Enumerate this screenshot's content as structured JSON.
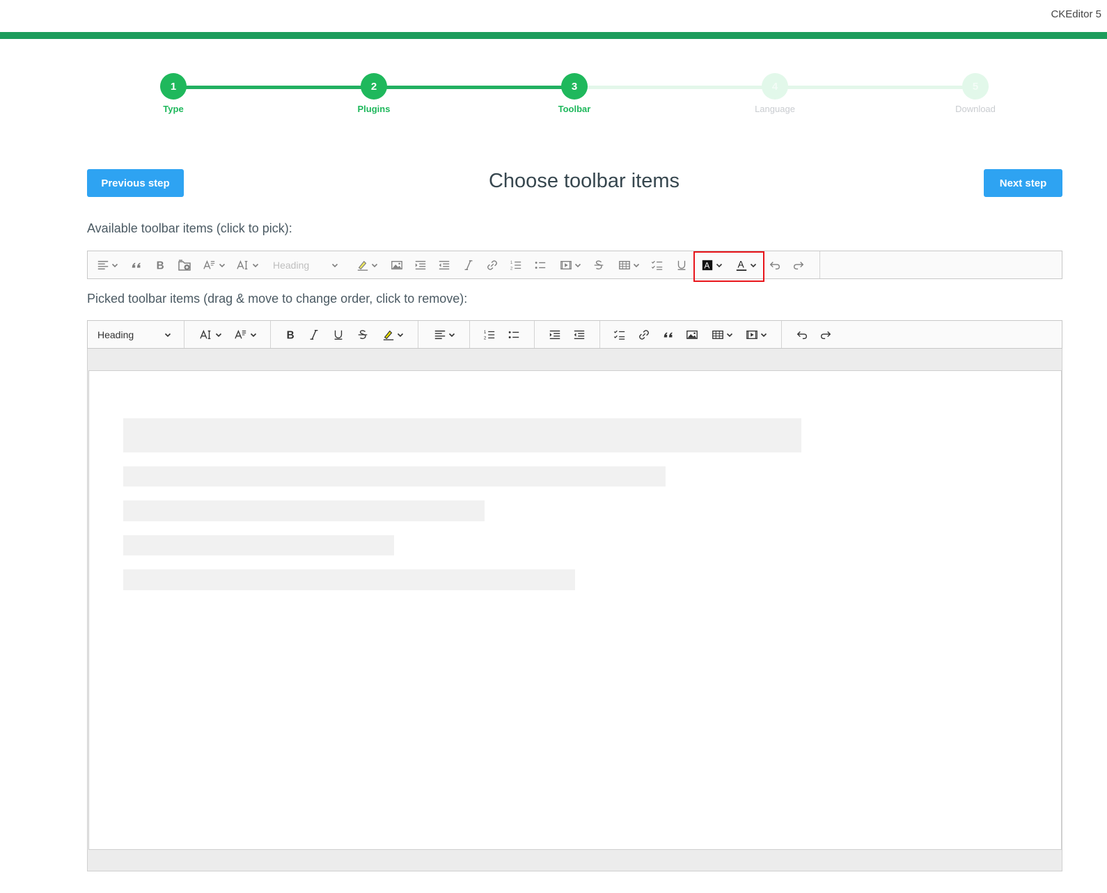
{
  "brand": "CKEditor 5",
  "colors": {
    "accent_green": "#1fb85c",
    "top_bar": "#1c9c5b",
    "button_blue": "#2ea3f2",
    "highlight_red": "#e8141a"
  },
  "steps": [
    {
      "number": "1",
      "label": "Type",
      "state": "done"
    },
    {
      "number": "2",
      "label": "Plugins",
      "state": "done"
    },
    {
      "number": "3",
      "label": "Toolbar",
      "state": "current"
    },
    {
      "number": "4",
      "label": "Language",
      "state": "todo"
    },
    {
      "number": "5",
      "label": "Download",
      "state": "todo"
    }
  ],
  "nav": {
    "previous": "Previous step",
    "next": "Next step"
  },
  "page_title": "Choose toolbar items",
  "available": {
    "label": "Available toolbar items (click to pick):",
    "heading_dropdown": "Heading",
    "items": [
      "alignment",
      "block-quote",
      "bold",
      "ckfinder",
      "font-size",
      "font-family",
      "heading",
      "highlight",
      "image-upload",
      "indent",
      "outdent",
      "italic",
      "link",
      "numbered-list",
      "bulleted-list",
      "media-embed",
      "strikethrough",
      "insert-table",
      "todo-list",
      "underline",
      "font-background-color",
      "font-color",
      "undo",
      "redo"
    ],
    "highlighted": [
      "font-background-color",
      "font-color"
    ]
  },
  "picked": {
    "label": "Picked toolbar items (drag & move to change order, click to remove):",
    "heading_dropdown": "Heading",
    "items": [
      "heading",
      "font-family",
      "font-size",
      "bold",
      "italic",
      "underline",
      "strikethrough",
      "highlight",
      "alignment",
      "numbered-list",
      "bulleted-list",
      "indent",
      "outdent",
      "todo-list",
      "link",
      "block-quote",
      "image-upload",
      "insert-table",
      "media-embed",
      "undo",
      "redo"
    ]
  }
}
